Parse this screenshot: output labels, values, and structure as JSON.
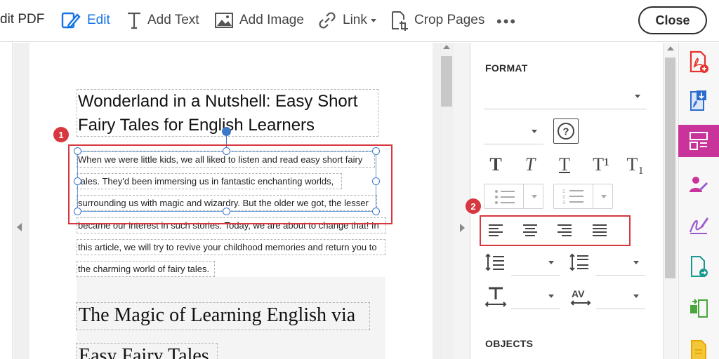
{
  "toolbar": {
    "title": "dit PDF",
    "edit_label": "Edit",
    "add_text_label": "Add Text",
    "add_image_label": "Add Image",
    "link_label": "Link",
    "crop_label": "Crop Pages",
    "more_label": "•••",
    "close_label": "Close"
  },
  "document": {
    "heading_line1": "Wonderland in a Nutshell: Easy Short",
    "heading_line2": "Fairy Tales for English Learners",
    "body_lines": [
      "When we were little kids, we all liked to listen and read easy short fairy",
      "tales. They'd been immersing us in fantastic enchanting worlds,",
      "surrounding us with magic and wizardry. But the older we got, the lesser",
      "became our interest in such stories. Today, we are about to change that! In",
      "this article, we will try to revive your childhood memories and return you to",
      "the charming world of fairy tales."
    ],
    "subheading1": "The Magic of Learning English via",
    "subheading2": "Easy Fairy Tales"
  },
  "annotations": {
    "badge1": "1",
    "badge2": "2"
  },
  "format_panel": {
    "format_title": "FORMAT",
    "objects_title": "OBJECTS",
    "help_label": "?",
    "style_icons": [
      "bold-text-icon",
      "italic-text-icon",
      "underline-text-icon",
      "superscript-icon",
      "subscript-icon"
    ],
    "style_glyphs": [
      "T",
      "T",
      "T",
      "T¹",
      "T₁"
    ],
    "align_icons": [
      "align-left-icon",
      "align-center-icon",
      "align-right-icon",
      "align-justify-icon"
    ]
  },
  "rail": {
    "icons": [
      "create-pdf-icon",
      "export-pdf-icon",
      "edit-pdf-icon",
      "request-signature-icon",
      "fill-sign-icon",
      "send-for-review-icon",
      "compare-files-icon",
      "more-tools-icon"
    ],
    "active": "edit-pdf-icon",
    "colors": [
      "#e5322d",
      "#2d6bcf",
      "#ffffff",
      "#c8349a",
      "#9b59d0",
      "#1a9a8f",
      "#48a63a",
      "#e8a800"
    ]
  },
  "colors": {
    "accent": "#1473e6",
    "annotation_red": "#d7373f",
    "selection_blue": "#3b78c7",
    "rail_active": "#c8349a"
  }
}
